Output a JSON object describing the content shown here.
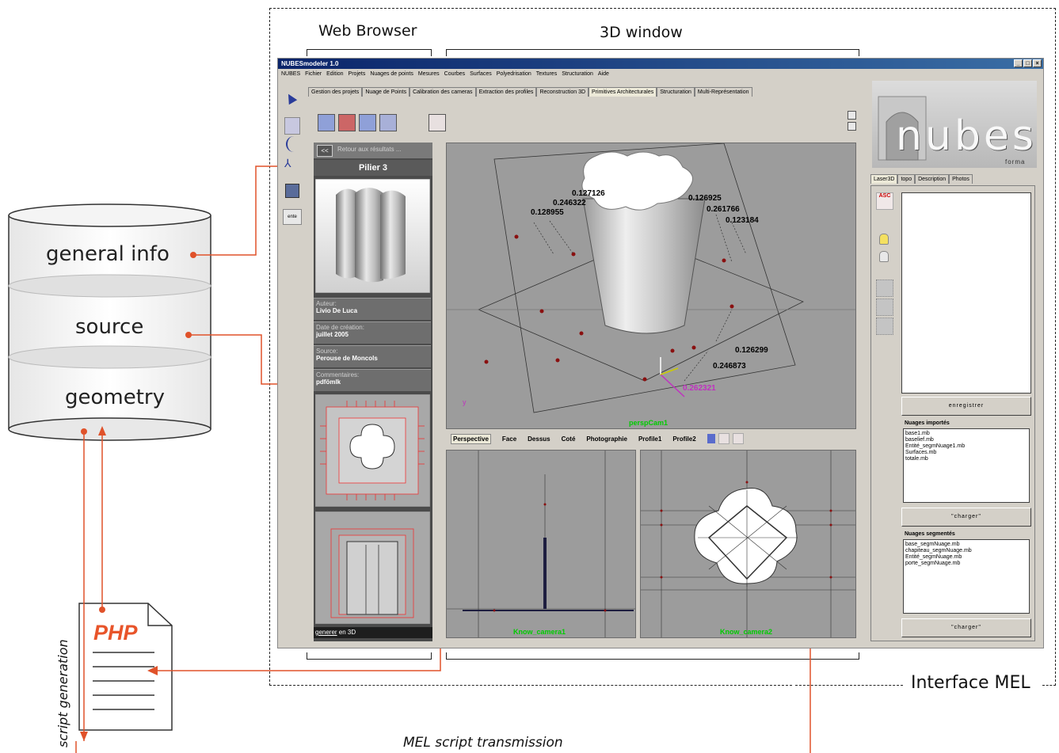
{
  "annotations": {
    "web_browser": "Web Browser",
    "window_3d": "3D window",
    "interface_mel": "Interface MEL",
    "mel_transmission": "MEL script transmission",
    "script_generation": "script generation",
    "php": "PHP"
  },
  "database": {
    "general_info": "general info",
    "source": "source",
    "geometry": "geometry"
  },
  "app": {
    "title": "NUBESmodeler 1.0",
    "menu": [
      "NUBES",
      "Fichier",
      "Edition",
      "Projets",
      "Nuages de points",
      "Mesures",
      "Courbes",
      "Surfaces",
      "Polyedrisation",
      "Textures",
      "Structuration",
      "Aide"
    ],
    "tabs": [
      "Gestion des projets",
      "Nuage de Points",
      "Calibration des cameras",
      "Extraction des profiles",
      "Reconstruction 3D",
      "Primitives Architecturales",
      "Structuration",
      "Multi-Représentation"
    ],
    "active_tab": "Primitives Architecturales",
    "side_tool_label": "ente"
  },
  "browser_panel": {
    "back_button": "<<",
    "back_text": "Retour aux résultats ...",
    "title": "Pilier 3",
    "author_label": "Auteur:",
    "author_value": "Livio De Luca",
    "date_label": "Date de création:",
    "date_value": "juillet 2005",
    "source_label": "Source:",
    "source_value": "Perouse de Moncols",
    "comments_label": "Commentaires:",
    "comments_value": "pdfömlk",
    "generate_button_a": "generer",
    "generate_button_b": " en 3D"
  },
  "viewport": {
    "persp_cam": "perspCam1",
    "cam1": "Know_camera1",
    "cam2": "Know_camera2",
    "measures": [
      "0.127126",
      "0.246322",
      "0.128955",
      "0.126925",
      "0.261766",
      "0.123184",
      "0.126299",
      "0.246873",
      "0.262321"
    ],
    "view_tabs": [
      "Perspective",
      "Face",
      "Dessus",
      "Coté",
      "Photographie",
      "Profile1",
      "Profile2"
    ]
  },
  "right_panel": {
    "logo_text": "nubes",
    "logo_sub": "forma",
    "tabs": [
      "Laser3D",
      "topo",
      "Description",
      "Photos"
    ],
    "save_button": "enregistrer",
    "imported_title": "Nuages importés",
    "imported_items": [
      "base1.mb",
      "baselief.mb",
      "Entité_segmNuage1.mb",
      "Surfaces.mb",
      "totale.mb"
    ],
    "load_button_1": "\"charger\"",
    "segmented_title": "Nuages segmentés",
    "segmented_items": [
      "base_segmNuage.mb",
      "chapiteau_segmNuage.mb",
      "Entité_segmNuage.mb",
      "porte_segmNuage.mb"
    ],
    "load_button_2": "\"charger\""
  }
}
